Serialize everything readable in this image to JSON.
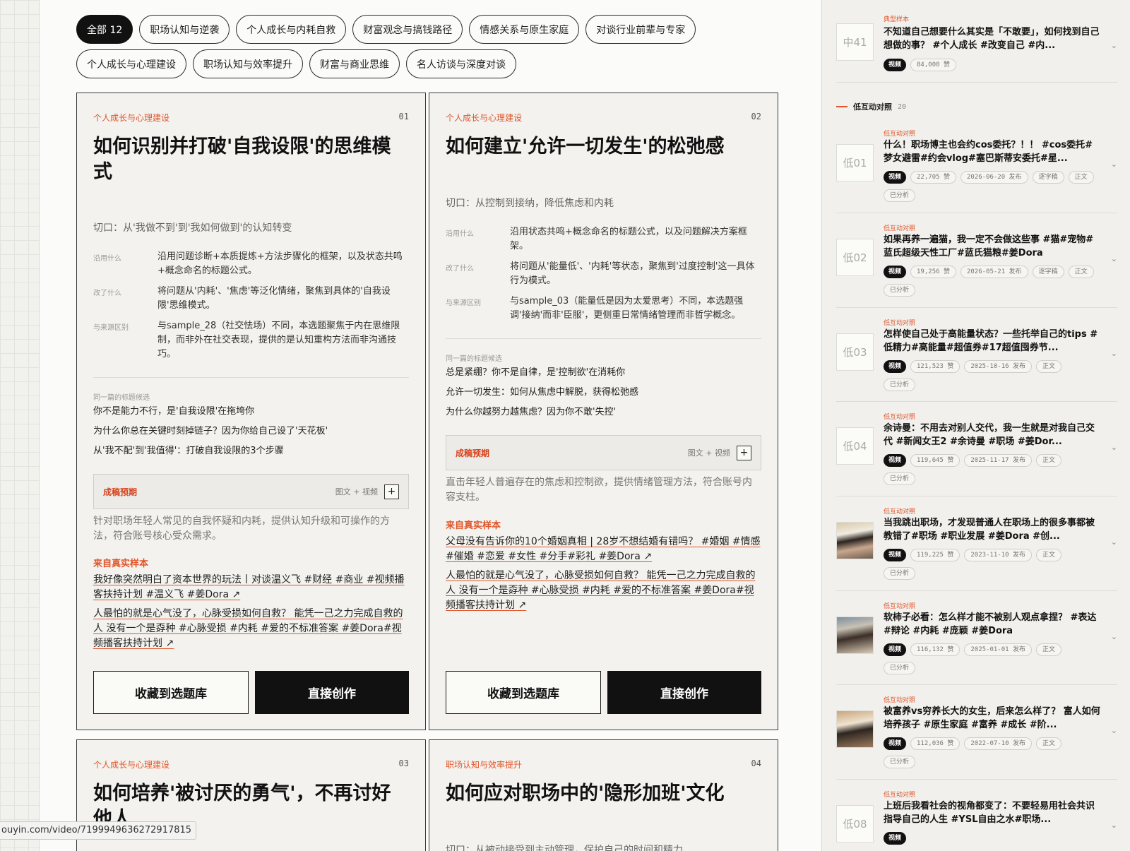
{
  "filters": {
    "row1": [
      "全部 12",
      "职场认知与逆袭",
      "个人成长与内耗自救",
      "财富观念与搞钱路径",
      "情感关系与原生家庭",
      "对谈行业前辈与专家"
    ],
    "row2": [
      "个人成长与心理建设",
      "职场认知与效率提升",
      "财富与商业思维",
      "名人访谈与深度对谈"
    ]
  },
  "labels": {
    "used": "沿用什么",
    "changed": "改了什么",
    "diff": "与来源区别",
    "candidates": "同一篇的标题候选",
    "expect": "成稿预期",
    "media": "图文 + 视频",
    "source": "来自真实样本",
    "save": "收藏到选题库",
    "create": "直接创作"
  },
  "cards": [
    {
      "category": "个人成长与心理建设",
      "number": "01",
      "title": "如何识别并打破'自我设限'的思维模式",
      "hook": "切口：从'我做不到'到'我如何做到'的认知转变",
      "used": "沿用问题诊断+本质提炼+方法步骤化的框架，以及状态共鸣+概念命名的标题公式。",
      "changed": "将问题从'内耗'、'焦虑'等泛化情绪，聚焦到具体的'自我设限'思维模式。",
      "diff": "与sample_28（社交怯场）不同，本选题聚焦于内在思维限制，而非外在社交表现，提供的是认知重构方法而非沟通技巧。",
      "candidates": [
        "你不是能力不行，是'自我设限'在拖垮你",
        "为什么你总在关键时刻掉链子？因为你给自己设了'天花板'",
        "从'我不配'到'我值得'：打破自我设限的3个步骤"
      ],
      "desc": "针对职场年轻人常见的自我怀疑和内耗，提供认知升级和可操作的方法，符合账号核心受众需求。",
      "sources": [
        "我好像突然明白了资本世界的玩法丨对谈温义飞 #财经 #商业 #视频播客扶持计划 #温义飞 #姜Dora ↗",
        "人最怕的就是心气没了，心脉受损如何自救？ 能凭一己之力完成自救的人 没有一个是孬种 #心脉受损 #内耗 #爱的不标准答案 #姜Dora#视频播客扶持计划 ↗"
      ]
    },
    {
      "category": "个人成长与心理建设",
      "number": "02",
      "title": "如何建立'允许一切发生'的松弛感",
      "hook": "切口：从控制到接纳，降低焦虑和内耗",
      "used": "沿用状态共鸣+概念命名的标题公式，以及问题解决方案框架。",
      "changed": "将问题从'能量低'、'内耗'等状态，聚焦到'过度控制'这一具体行为模式。",
      "diff": "与sample_03（能量低是因为太爱思考）不同，本选题强调'接纳'而非'臣服'，更侧重日常情绪管理而非哲学概念。",
      "candidates": [
        "总是紧绷？你不是自律，是'控制欲'在消耗你",
        "允许一切发生：如何从焦虑中解脱，获得松弛感",
        "为什么你越努力越焦虑？因为你不敢'失控'"
      ],
      "desc": "直击年轻人普遍存在的焦虑和控制欲，提供情绪管理方法，符合账号内容支柱。",
      "sources": [
        "父母没有告诉你的10个婚姻真相 | 28岁不想结婚有错吗？ #婚姻 #情感 #催婚 #恋爱 #女性 #分手#彩礼 #姜Dora ↗",
        "人最怕的就是心气没了，心脉受损如何自救？ 能凭一己之力完成自救的人 没有一个是孬种 #心脉受损 #内耗 #爱的不标准答案 #姜Dora#视频播客扶持计划 ↗"
      ]
    },
    {
      "category": "个人成长与心理建设",
      "number": "03",
      "title": "如何培养'被讨厌的勇气'，不再讨好他人"
    },
    {
      "category": "职场认知与效率提升",
      "number": "04",
      "title": "如何应对职场中的'隐形加班'文化",
      "hook": "切口：从被动接受到主动管理，保护自己的时间和精力"
    }
  ],
  "url_tooltip": "ouyin.com/video/7199949636272917815",
  "sidebar": {
    "top_item": {
      "tag": "典型样本",
      "thumb": "中41",
      "title": "不知道自己想要什么其实是「不敢要」，如何找到自己想做的事？ #个人成长 #改变自己 #内...",
      "badges": [
        "视频",
        "84,000 赞"
      ]
    },
    "section_title": "低互动对照",
    "section_count": "20",
    "items": [
      {
        "tag": "低互动对照",
        "thumb": "低01",
        "title": "什么！职场博主也会约cos委托？！！ #cos委托#梦女避雷#约会vlog#塞巴斯蒂安委托#星...",
        "badges": [
          "视频",
          "22,705 赞",
          "2026-06-20 发布",
          "逐字稿",
          "正文",
          "已分析"
        ]
      },
      {
        "tag": "低互动对照",
        "thumb": "低02",
        "title": "如果再养一遍猫，我一定不会做这些事 #猫#宠物#蓝氏超级天性工厂#蓝氏猫粮#姜Dora",
        "badges": [
          "视频",
          "19,256 赞",
          "2026-05-21 发布",
          "逐字稿",
          "正文",
          "已分析"
        ]
      },
      {
        "tag": "低互动对照",
        "thumb": "低03",
        "title": "怎样使自己处于高能量状态？一些托举自己的tips #低精力#高能量#超值券#17超值囤券节...",
        "badges": [
          "视频",
          "121,523 赞",
          "2025-10-16 发布",
          "正文",
          "已分析"
        ]
      },
      {
        "tag": "低互动对照",
        "thumb": "低04",
        "title": "余诗曼：不用去对别人交代，我一生就是对我自己交代 #新闻女王2 #余诗曼 #职场 #姜Dor...",
        "badges": [
          "视频",
          "119,645 赞",
          "2025-11-17 发布",
          "正文",
          "已分析"
        ]
      },
      {
        "tag": "低互动对照",
        "thumb": "",
        "title": "当我跳出职场，才发现普通人在职场上的很多事都被教错了#职场 #职业发展 #姜Dora #创...",
        "badges": [
          "视频",
          "119,225 赞",
          "2023-11-10 发布",
          "正文",
          "已分析"
        ]
      },
      {
        "tag": "低互动对照",
        "thumb": "",
        "title": "软柿子必看：怎么样才能不被别人观点拿捏？ #表达 #辩论 #内耗 #庞颖 #姜Dora",
        "badges": [
          "视频",
          "116,132 赞",
          "2025-01-01 发布",
          "正文",
          "已分析"
        ]
      },
      {
        "tag": "低互动对照",
        "thumb": "",
        "title": "被富养vs穷养长大的女生，后来怎么样了？ 富人如何培养孩子 #原生家庭 #富养 #成长 #阶...",
        "badges": [
          "视频",
          "112,036 赞",
          "2022-07-10 发布",
          "正文",
          "已分析"
        ]
      },
      {
        "tag": "低互动对照",
        "thumb": "低08",
        "title": "上班后我看社会的视角都变了：不要轻易用社会共识指导自己的人生 #YSL自由之水#职场...",
        "badges": [
          "视频"
        ]
      }
    ]
  }
}
